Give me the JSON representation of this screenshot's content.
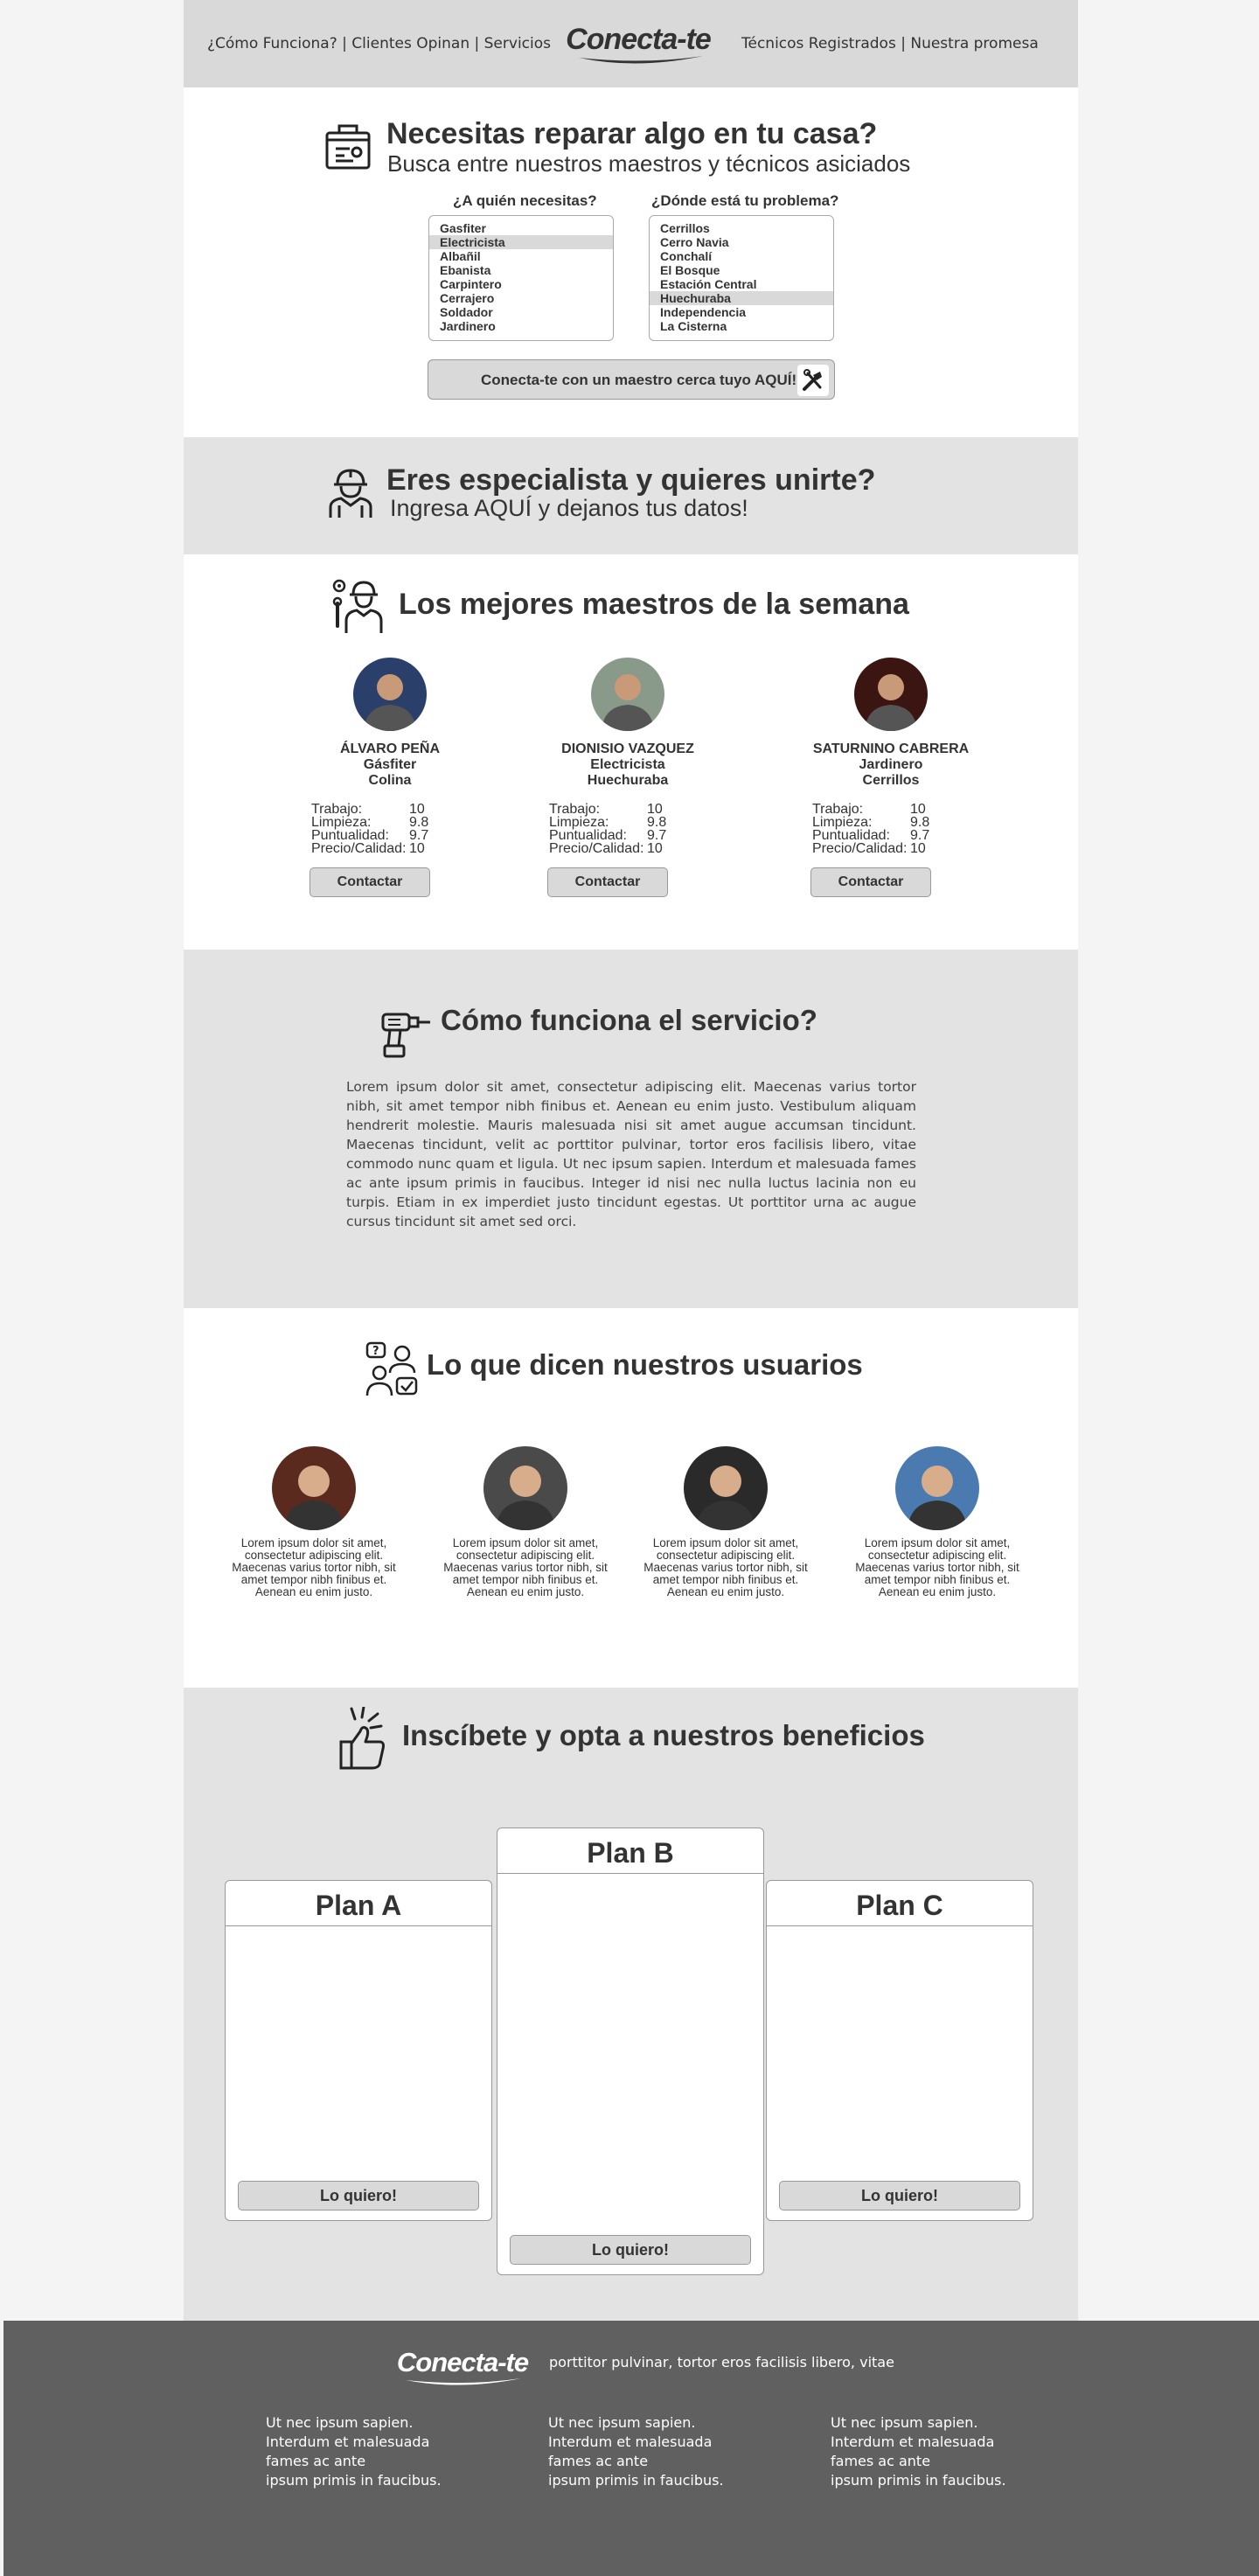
{
  "header": {
    "nav_left": [
      "¿Cómo Funciona?",
      "Clientes Opinan",
      "Servicios"
    ],
    "nav_right": [
      "Técnicos Registrados",
      "Nuestra promesa"
    ],
    "separator": " | ",
    "logo_text": "Conecta-te"
  },
  "search": {
    "title": "Necesitas reparar algo en tu casa?",
    "subtitle": "Busca entre nuestros maestros y técnicos asiciados",
    "who_label": "¿A quién necesitas?",
    "who_options": [
      "Gasfiter",
      "Electricista",
      "Albañil",
      "Ebanista",
      "Carpintero",
      "Cerrajero",
      "Soldador",
      "Jardinero"
    ],
    "who_selected": "Electricista",
    "where_label": "¿Dónde está tu problema?",
    "where_options": [
      "Cerrillos",
      "Cerro Navia",
      "Conchalí",
      "El Bosque",
      "Estación Central",
      "Huechuraba",
      "Independencia",
      "La Cisterna"
    ],
    "where_selected": "Huechuraba",
    "cta_label": "Conecta-te con un maestro cerca tuyo AQUÍ!",
    "cta_icon": "tools-icon"
  },
  "join": {
    "title": "Eres especialista y quieres unirte?",
    "subtitle": "Ingresa AQUÍ y dejanos tus datos!"
  },
  "best": {
    "title": "Los mejores maestros de la semana",
    "stat_labels": [
      "Trabajo:",
      "Limpieza:",
      "Puntualidad:",
      "Precio/Calidad:"
    ],
    "contact_label": "Contactar",
    "workers": [
      {
        "name": "ÁLVARO PEÑA",
        "trade": "Gásfiter",
        "city": "Colina",
        "stats": [
          "10",
          "9.8",
          "9.7",
          "10"
        ],
        "avatar_bg": "#2b3f6b"
      },
      {
        "name": "DIONISIO VAZQUEZ",
        "trade": "Electricista",
        "city": "Huechuraba",
        "stats": [
          "10",
          "9.8",
          "9.7",
          "10"
        ],
        "avatar_bg": "#8a9a8a"
      },
      {
        "name": "SATURNINO CABRERA",
        "trade": "Jardinero",
        "city": "Cerrillos",
        "stats": [
          "10",
          "9.8",
          "9.7",
          "10"
        ],
        "avatar_bg": "#3a1512"
      }
    ]
  },
  "how": {
    "title": "Cómo funciona el servicio?",
    "body": "Lorem ipsum dolor sit amet, consectetur adipiscing elit. Maecenas varius tortor nibh, sit amet tempor nibh finibus et. Aenean eu enim justo. Vestibulum aliquam hendrerit molestie. Mauris malesuada nisi sit amet augue accumsan tincidunt. Maecenas tincidunt, velit ac porttitor pulvinar, tortor eros facilisis libero, vitae commodo nunc quam et ligula. Ut nec ipsum sapien. Interdum et malesuada fames ac ante ipsum primis in faucibus. Integer id nisi nec nulla luctus lacinia non eu turpis. Etiam in ex imperdiet justo tincidunt egestas. Ut porttitor urna ac augue cursus tincidunt sit amet sed orci."
  },
  "testimonials": {
    "title": "Lo que dicen nuestros usuarios",
    "users": [
      {
        "quote": "Lorem ipsum dolor sit amet, consectetur adipiscing elit. Maecenas varius tortor nibh, sit amet tempor nibh finibus et. Aenean eu enim justo.",
        "avatar_bg": "#5a2a1e"
      },
      {
        "quote": "Lorem ipsum dolor sit amet, consectetur adipiscing elit. Maecenas varius tortor nibh, sit amet tempor nibh finibus et. Aenean eu enim justo.",
        "avatar_bg": "#4a4a4a"
      },
      {
        "quote": "Lorem ipsum dolor sit amet, consectetur adipiscing elit. Maecenas varius tortor nibh, sit amet tempor nibh finibus et. Aenean eu enim justo.",
        "avatar_bg": "#2a2a2a"
      },
      {
        "quote": "Lorem ipsum dolor sit amet, consectetur adipiscing elit. Maecenas varius tortor nibh, sit amet tempor nibh finibus et. Aenean eu enim justo.",
        "avatar_bg": "#4a7ab0"
      }
    ]
  },
  "plans": {
    "title": "Inscíbete y opta a nuestros beneficios",
    "button_label": "Lo quiero!",
    "items": [
      {
        "name": "Plan A"
      },
      {
        "name": "Plan B"
      },
      {
        "name": "Plan C"
      }
    ]
  },
  "footer": {
    "logo_text": "Conecta-te",
    "tagline": "porttitor pulvinar, tortor eros facilisis libero, vitae",
    "columns": [
      [
        "Ut nec ipsum sapien.",
        "Interdum et malesuada",
        "fames ac ante",
        "ipsum primis in faucibus."
      ],
      [
        "Ut nec ipsum sapien.",
        "Interdum et malesuada",
        "fames ac ante",
        "ipsum primis in faucibus."
      ],
      [
        "Ut nec ipsum sapien.",
        "Interdum et malesuada",
        "fames ac ante",
        "ipsum primis in faucibus."
      ]
    ]
  },
  "colors": {
    "header_bg": "#d9d9d9",
    "alt_section_bg": "#e3e3e3",
    "footer_bg": "#606060",
    "text": "#333333"
  }
}
